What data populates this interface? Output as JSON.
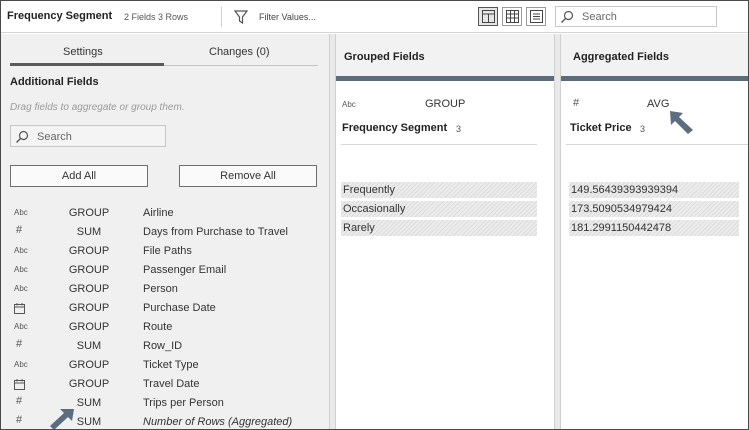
{
  "topbar": {
    "step_title": "Frequency Segment",
    "step_meta": "2 Fields  3 Rows",
    "filter_label": "Filter Values...",
    "search_placeholder": "Search"
  },
  "left_panel": {
    "tabs": [
      {
        "label": "Settings",
        "active": true
      },
      {
        "label": "Changes (0)",
        "active": false
      }
    ],
    "section_title": "Additional Fields",
    "hint": "Drag fields to aggregate or group them.",
    "search_placeholder": "Search",
    "add_all_label": "Add All",
    "remove_all_label": "Remove All",
    "fields": [
      {
        "type": "Abc",
        "aggregation": "GROUP",
        "name": "Airline"
      },
      {
        "type": "#",
        "aggregation": "SUM",
        "name": "Days from Purchase to Travel"
      },
      {
        "type": "Abc",
        "aggregation": "GROUP",
        "name": "File Paths"
      },
      {
        "type": "Abc",
        "aggregation": "GROUP",
        "name": "Passenger Email"
      },
      {
        "type": "Abc",
        "aggregation": "GROUP",
        "name": "Person"
      },
      {
        "type": "calendar",
        "aggregation": "GROUP",
        "name": "Purchase Date"
      },
      {
        "type": "Abc",
        "aggregation": "GROUP",
        "name": "Route"
      },
      {
        "type": "#",
        "aggregation": "SUM",
        "name": "Row_ID"
      },
      {
        "type": "Abc",
        "aggregation": "GROUP",
        "name": "Ticket Type"
      },
      {
        "type": "calendar",
        "aggregation": "GROUP",
        "name": "Travel Date"
      },
      {
        "type": "#",
        "aggregation": "SUM",
        "name": "Trips per Person"
      },
      {
        "type": "#",
        "aggregation": "SUM",
        "name": "Number of Rows (Aggregated)"
      }
    ]
  },
  "grouped_panel": {
    "title": "Grouped Fields",
    "field_type": "Abc",
    "aggregation": "GROUP",
    "field_name": "Frequency Segment",
    "count": "3",
    "values": [
      "Frequently",
      "Occasionally",
      "Rarely"
    ]
  },
  "aggregated_panel": {
    "title": "Aggregated Fields",
    "field_type": "#",
    "aggregation": "AVG",
    "field_name": "Ticket Price",
    "count": "3",
    "values": [
      "149.56439393939394",
      "173.5090534979424",
      "181.2991150442478"
    ]
  },
  "icons": {
    "filter": "filter-icon",
    "view_modes": [
      "profile-view-icon",
      "table-view-icon",
      "list-view-icon"
    ],
    "search": "search-icon",
    "pointer": "arrow-pointer-icon"
  },
  "colors": {
    "panel_bar": "#5e6c79",
    "arrow": "#5b6d7e"
  }
}
